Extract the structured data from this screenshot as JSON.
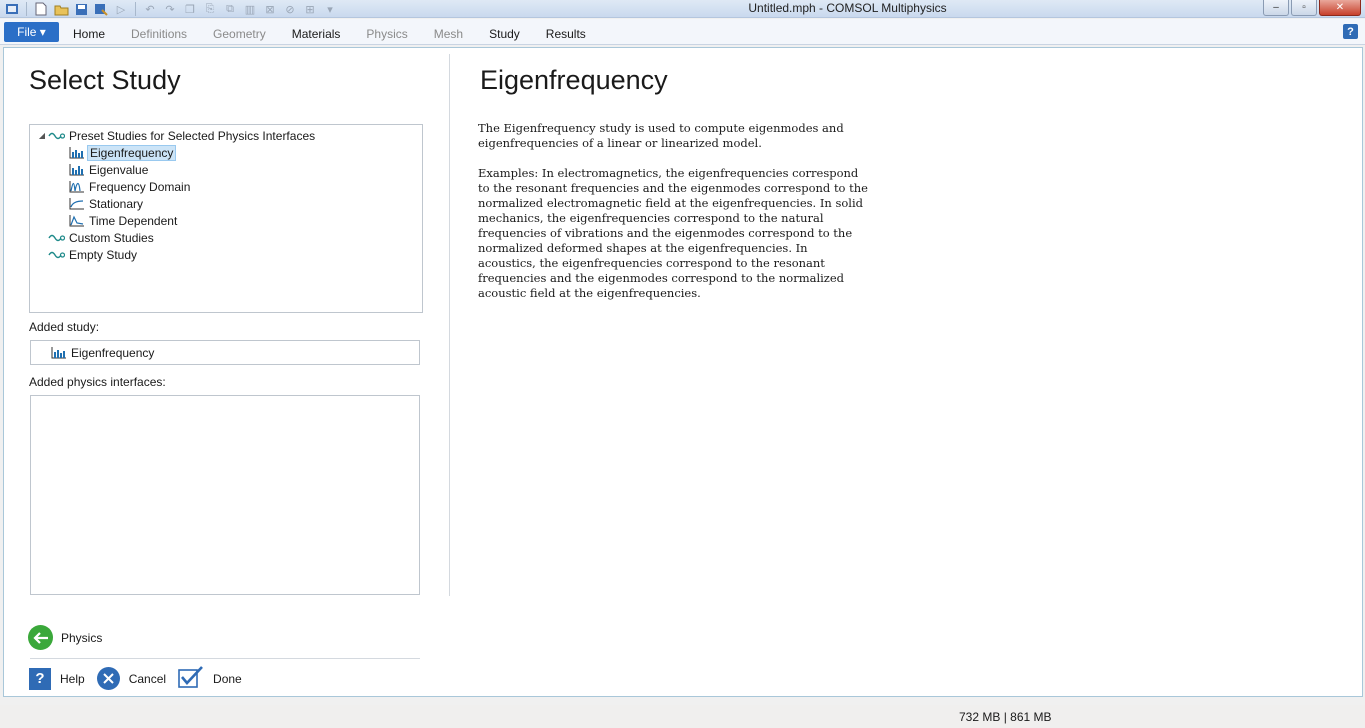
{
  "window": {
    "title": "Untitled.mph - COMSOL Multiphysics",
    "minimize": "‒",
    "maximize": "▫",
    "close": "✕"
  },
  "quick_access": {
    "icons": [
      "app-icon",
      "new-file-icon",
      "open-file-icon",
      "save-icon",
      "save-as-icon",
      "run-icon",
      "undo-icon",
      "redo-icon",
      "copy-icon",
      "paste-icon",
      "duplicate-icon",
      "delete-icon",
      "build-icon",
      "clear-icon",
      "compute-icon",
      "dropdown-icon"
    ]
  },
  "ribbon": {
    "file_label": "File ▾",
    "tabs": [
      {
        "label": "Home",
        "enabled": true
      },
      {
        "label": "Definitions",
        "enabled": false
      },
      {
        "label": "Geometry",
        "enabled": false
      },
      {
        "label": "Materials",
        "enabled": true
      },
      {
        "label": "Physics",
        "enabled": false
      },
      {
        "label": "Mesh",
        "enabled": false
      },
      {
        "label": "Study",
        "enabled": true
      },
      {
        "label": "Results",
        "enabled": true
      }
    ],
    "help": "?"
  },
  "left": {
    "title": "Select Study",
    "tree": {
      "root_label": "Preset Studies for Selected Physics Interfaces",
      "children": [
        {
          "label": "Eigenfrequency",
          "icon": "eigenfrequency-icon",
          "selected": true
        },
        {
          "label": "Eigenvalue",
          "icon": "eigenvalue-icon",
          "selected": false
        },
        {
          "label": "Frequency Domain",
          "icon": "frequency-domain-icon",
          "selected": false
        },
        {
          "label": "Stationary",
          "icon": "stationary-icon",
          "selected": false
        },
        {
          "label": "Time Dependent",
          "icon": "time-dependent-icon",
          "selected": false
        }
      ],
      "custom_label": "Custom Studies",
      "empty_label": "Empty Study"
    },
    "added_study_label": "Added study:",
    "added_study_value": "Eigenfrequency",
    "added_physics_label": "Added physics interfaces:",
    "back_label": "Physics",
    "help_label": "Help",
    "cancel_label": "Cancel",
    "done_label": "Done"
  },
  "right": {
    "title": "Eigenfrequency",
    "paragraph1": "The Eigenfrequency study is used to compute eigenmodes and eigenfrequencies of a linear or linearized model.",
    "paragraph2": "Examples: In electromagnetics, the eigenfrequencies correspond to the resonant frequencies and the eigenmodes correspond to the normalized electromagnetic field at the eigenfrequencies. In solid mechanics, the eigenfrequencies correspond to the natural frequencies of vibrations and the eigenmodes correspond to the normalized deformed shapes at the eigenfrequencies. In acoustics, the eigenfrequencies correspond to the resonant frequencies and the eigenmodes correspond to the normalized acoustic field at the eigenfrequencies."
  },
  "status": {
    "memory": "732 MB | 861 MB"
  },
  "colors": {
    "accent": "#2b6fc7",
    "selection": "#cce4f7",
    "back_green": "#3aa83a",
    "study_icon_teal": "#1f8a8a"
  }
}
